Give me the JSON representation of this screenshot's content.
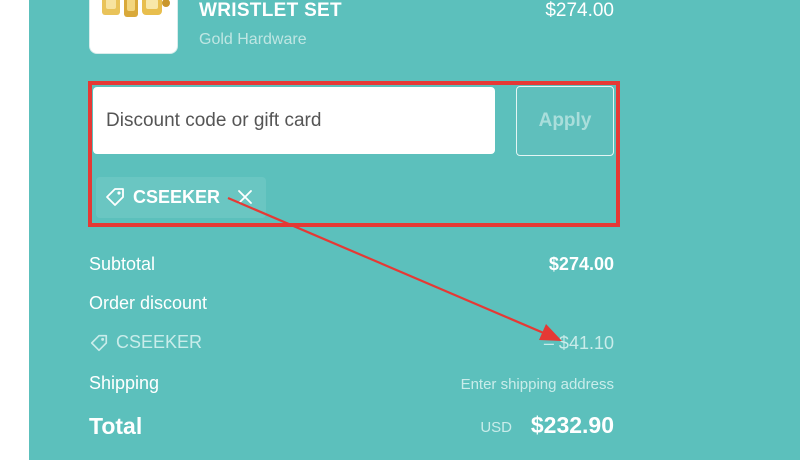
{
  "product": {
    "name": "WRISTLET SET",
    "variant": "Gold Hardware",
    "price": "$274.00"
  },
  "discount": {
    "placeholder": "Discount code or gift card",
    "apply_label": "Apply",
    "applied_code": "CSEEKER"
  },
  "summary": {
    "subtotal_label": "Subtotal",
    "subtotal_value": "$274.00",
    "order_discount_label": "Order discount",
    "discount_code": "CSEEKER",
    "discount_amount": "– $41.10",
    "shipping_label": "Shipping",
    "shipping_value": "Enter shipping address",
    "total_label": "Total",
    "currency": "USD",
    "total_value": "$232.90"
  },
  "colors": {
    "panel_bg": "#5cc0bc",
    "annotation_red": "#e53935",
    "text_white": "#ffffff"
  },
  "icons": [
    "tag-icon",
    "close-icon",
    "arrow-annotation"
  ]
}
